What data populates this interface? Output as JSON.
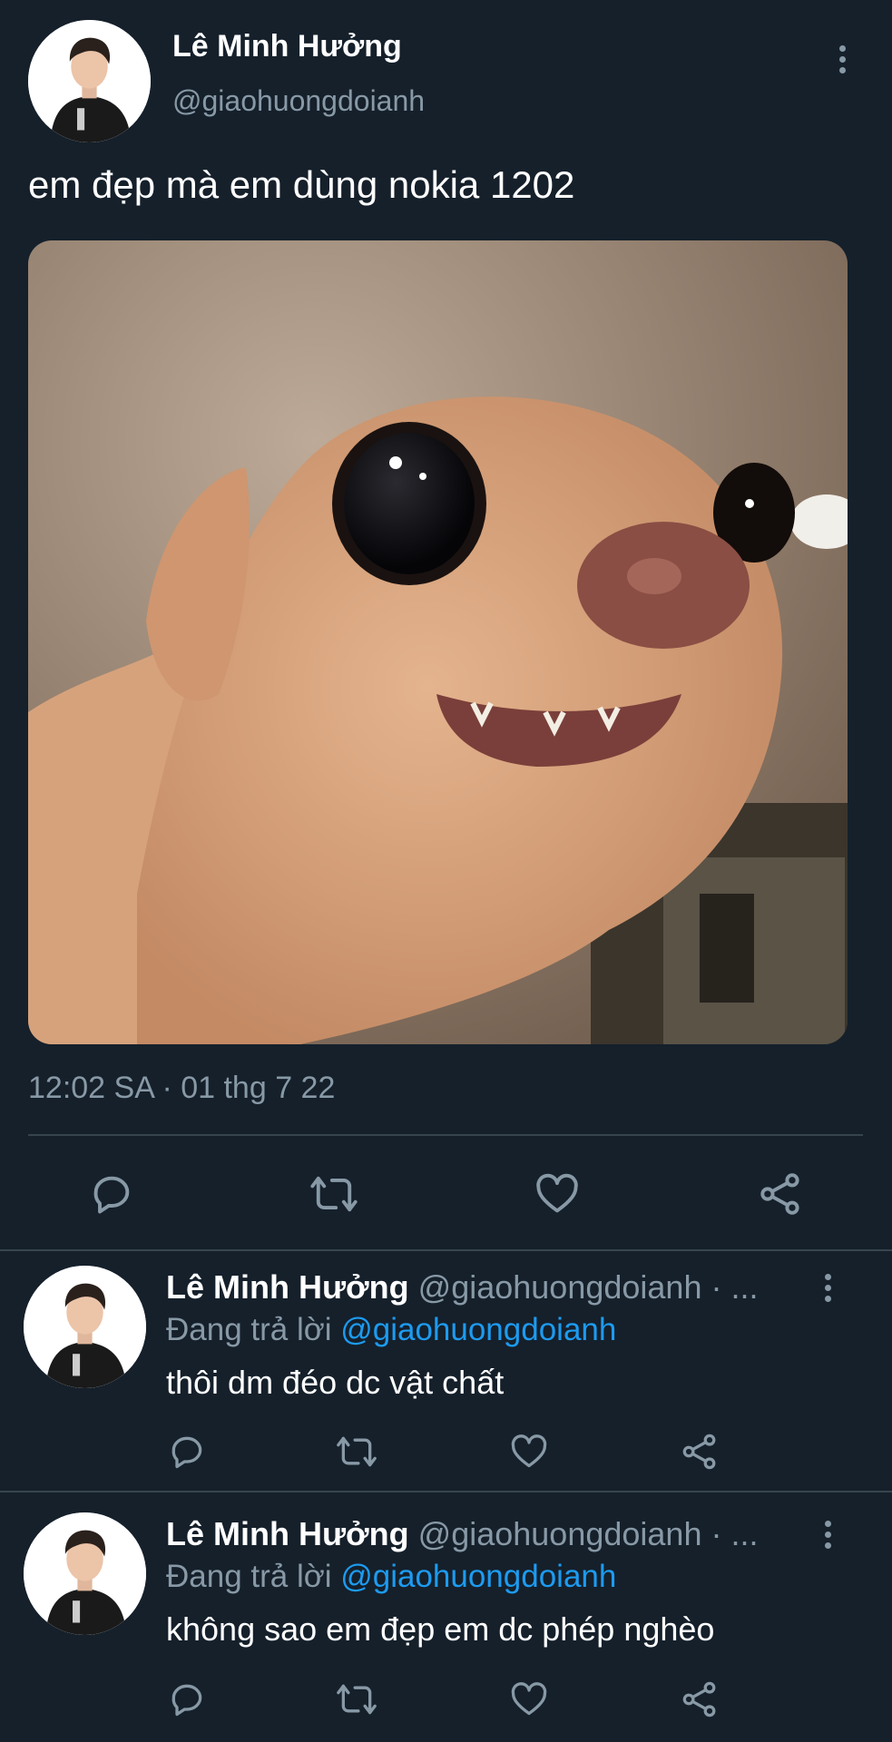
{
  "main_tweet": {
    "author_name": "Lê Minh Hưởng",
    "author_handle": "@giaohuongdoianh",
    "text": "em đẹp mà em dùng nokia 1202",
    "timestamp": "12:02 SA · 01 thg 7 22",
    "image_alt": "chihuahua-meme"
  },
  "replies": [
    {
      "author_name": "Lê Minh Hưởng",
      "author_handle": "@giaohuongdoianh · ...",
      "replying_prefix": "Đang trả lời",
      "replying_to": "@giaohuongdoianh",
      "text": "thôi dm đéo dc vật chất"
    },
    {
      "author_name": "Lê Minh Hưởng",
      "author_handle": "@giaohuongdoianh · ...",
      "replying_prefix": "Đang trả lời",
      "replying_to": "@giaohuongdoianh",
      "text": "không sao em đẹp em dc phép nghèo"
    }
  ],
  "colors": {
    "background": "#15202b",
    "secondary_text": "#8899a6",
    "link": "#1d9bf0",
    "divider": "#38444d"
  },
  "icons": [
    "reply-icon",
    "retweet-icon",
    "like-icon",
    "share-icon",
    "more-options-icon"
  ]
}
